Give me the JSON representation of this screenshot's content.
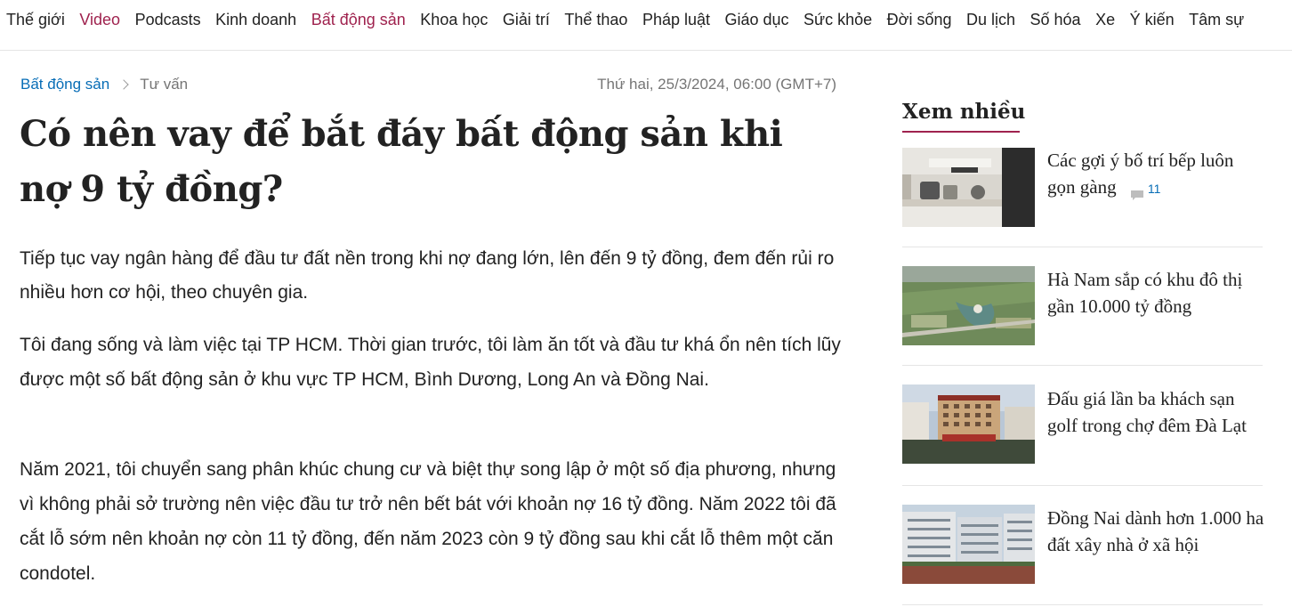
{
  "nav": {
    "items": [
      {
        "label": "Thế giới",
        "accent": false
      },
      {
        "label": "Video",
        "accent": true
      },
      {
        "label": "Podcasts",
        "accent": false
      },
      {
        "label": "Kinh doanh",
        "accent": false
      },
      {
        "label": "Bất động sản",
        "accent": true
      },
      {
        "label": "Khoa học",
        "accent": false
      },
      {
        "label": "Giải trí",
        "accent": false
      },
      {
        "label": "Thể thao",
        "accent": false
      },
      {
        "label": "Pháp luật",
        "accent": false
      },
      {
        "label": "Giáo dục",
        "accent": false
      },
      {
        "label": "Sức khỏe",
        "accent": false
      },
      {
        "label": "Đời sống",
        "accent": false
      },
      {
        "label": "Du lịch",
        "accent": false
      },
      {
        "label": "Số hóa",
        "accent": false
      },
      {
        "label": "Xe",
        "accent": false
      },
      {
        "label": "Ý kiến",
        "accent": false
      },
      {
        "label": "Tâm sự",
        "accent": false
      }
    ]
  },
  "breadcrumb": {
    "category": "Bất động sản",
    "subcategory": "Tư vấn"
  },
  "article": {
    "date": "Thứ hai, 25/3/2024, 06:00 (GMT+7)",
    "title": "Có nên vay để bắt đáy bất động sản khi nợ 9 tỷ đồng?",
    "lead": "Tiếp tục vay ngân hàng để đầu tư đất nền trong khi nợ đang lớn, lên đến 9 tỷ đồng, đem đến rủi ro nhiều hơn cơ hội, theo chuyên gia.",
    "paragraphs": [
      "Tôi đang sống và làm việc tại TP HCM. Thời gian trước, tôi làm ăn tốt và đầu tư khá ổn nên tích lũy được một số bất động sản ở khu vực TP HCM, Bình Dương, Long An và Đồng Nai.",
      "Năm 2021, tôi chuyển sang phân khúc chung cư và biệt thự song lập ở một số địa phương, nhưng vì không phải sở trường nên việc đầu tư trở nên bết bát với khoản nợ 16 tỷ đồng. Năm 2022 tôi đã cắt lỗ sớm nên khoản nợ còn 11 tỷ đồng, đến năm 2023 còn 9 tỷ đồng sau khi cắt lỗ thêm một căn condotel."
    ]
  },
  "sidebar": {
    "heading": "Xem nhiều",
    "items": [
      {
        "title": "Các gợi ý bố trí bếp luôn gọn gàng",
        "comments": "11",
        "image": "kitchen-photo"
      },
      {
        "title": "Hà Nam sắp có khu đô thị gần 10.000 tỷ đồng",
        "image": "urban-area-aerial-photo"
      },
      {
        "title": "Đấu giá lần ba khách sạn golf trong chợ đêm Đà Lạt",
        "image": "hotel-building-photo"
      },
      {
        "title": "Đồng Nai dành hơn 1.000 ha đất xây nhà ở xã hội",
        "image": "apartment-blocks-photo"
      }
    ]
  },
  "colors": {
    "accent": "#9f224e",
    "link": "#076db6",
    "muted": "#757575"
  }
}
